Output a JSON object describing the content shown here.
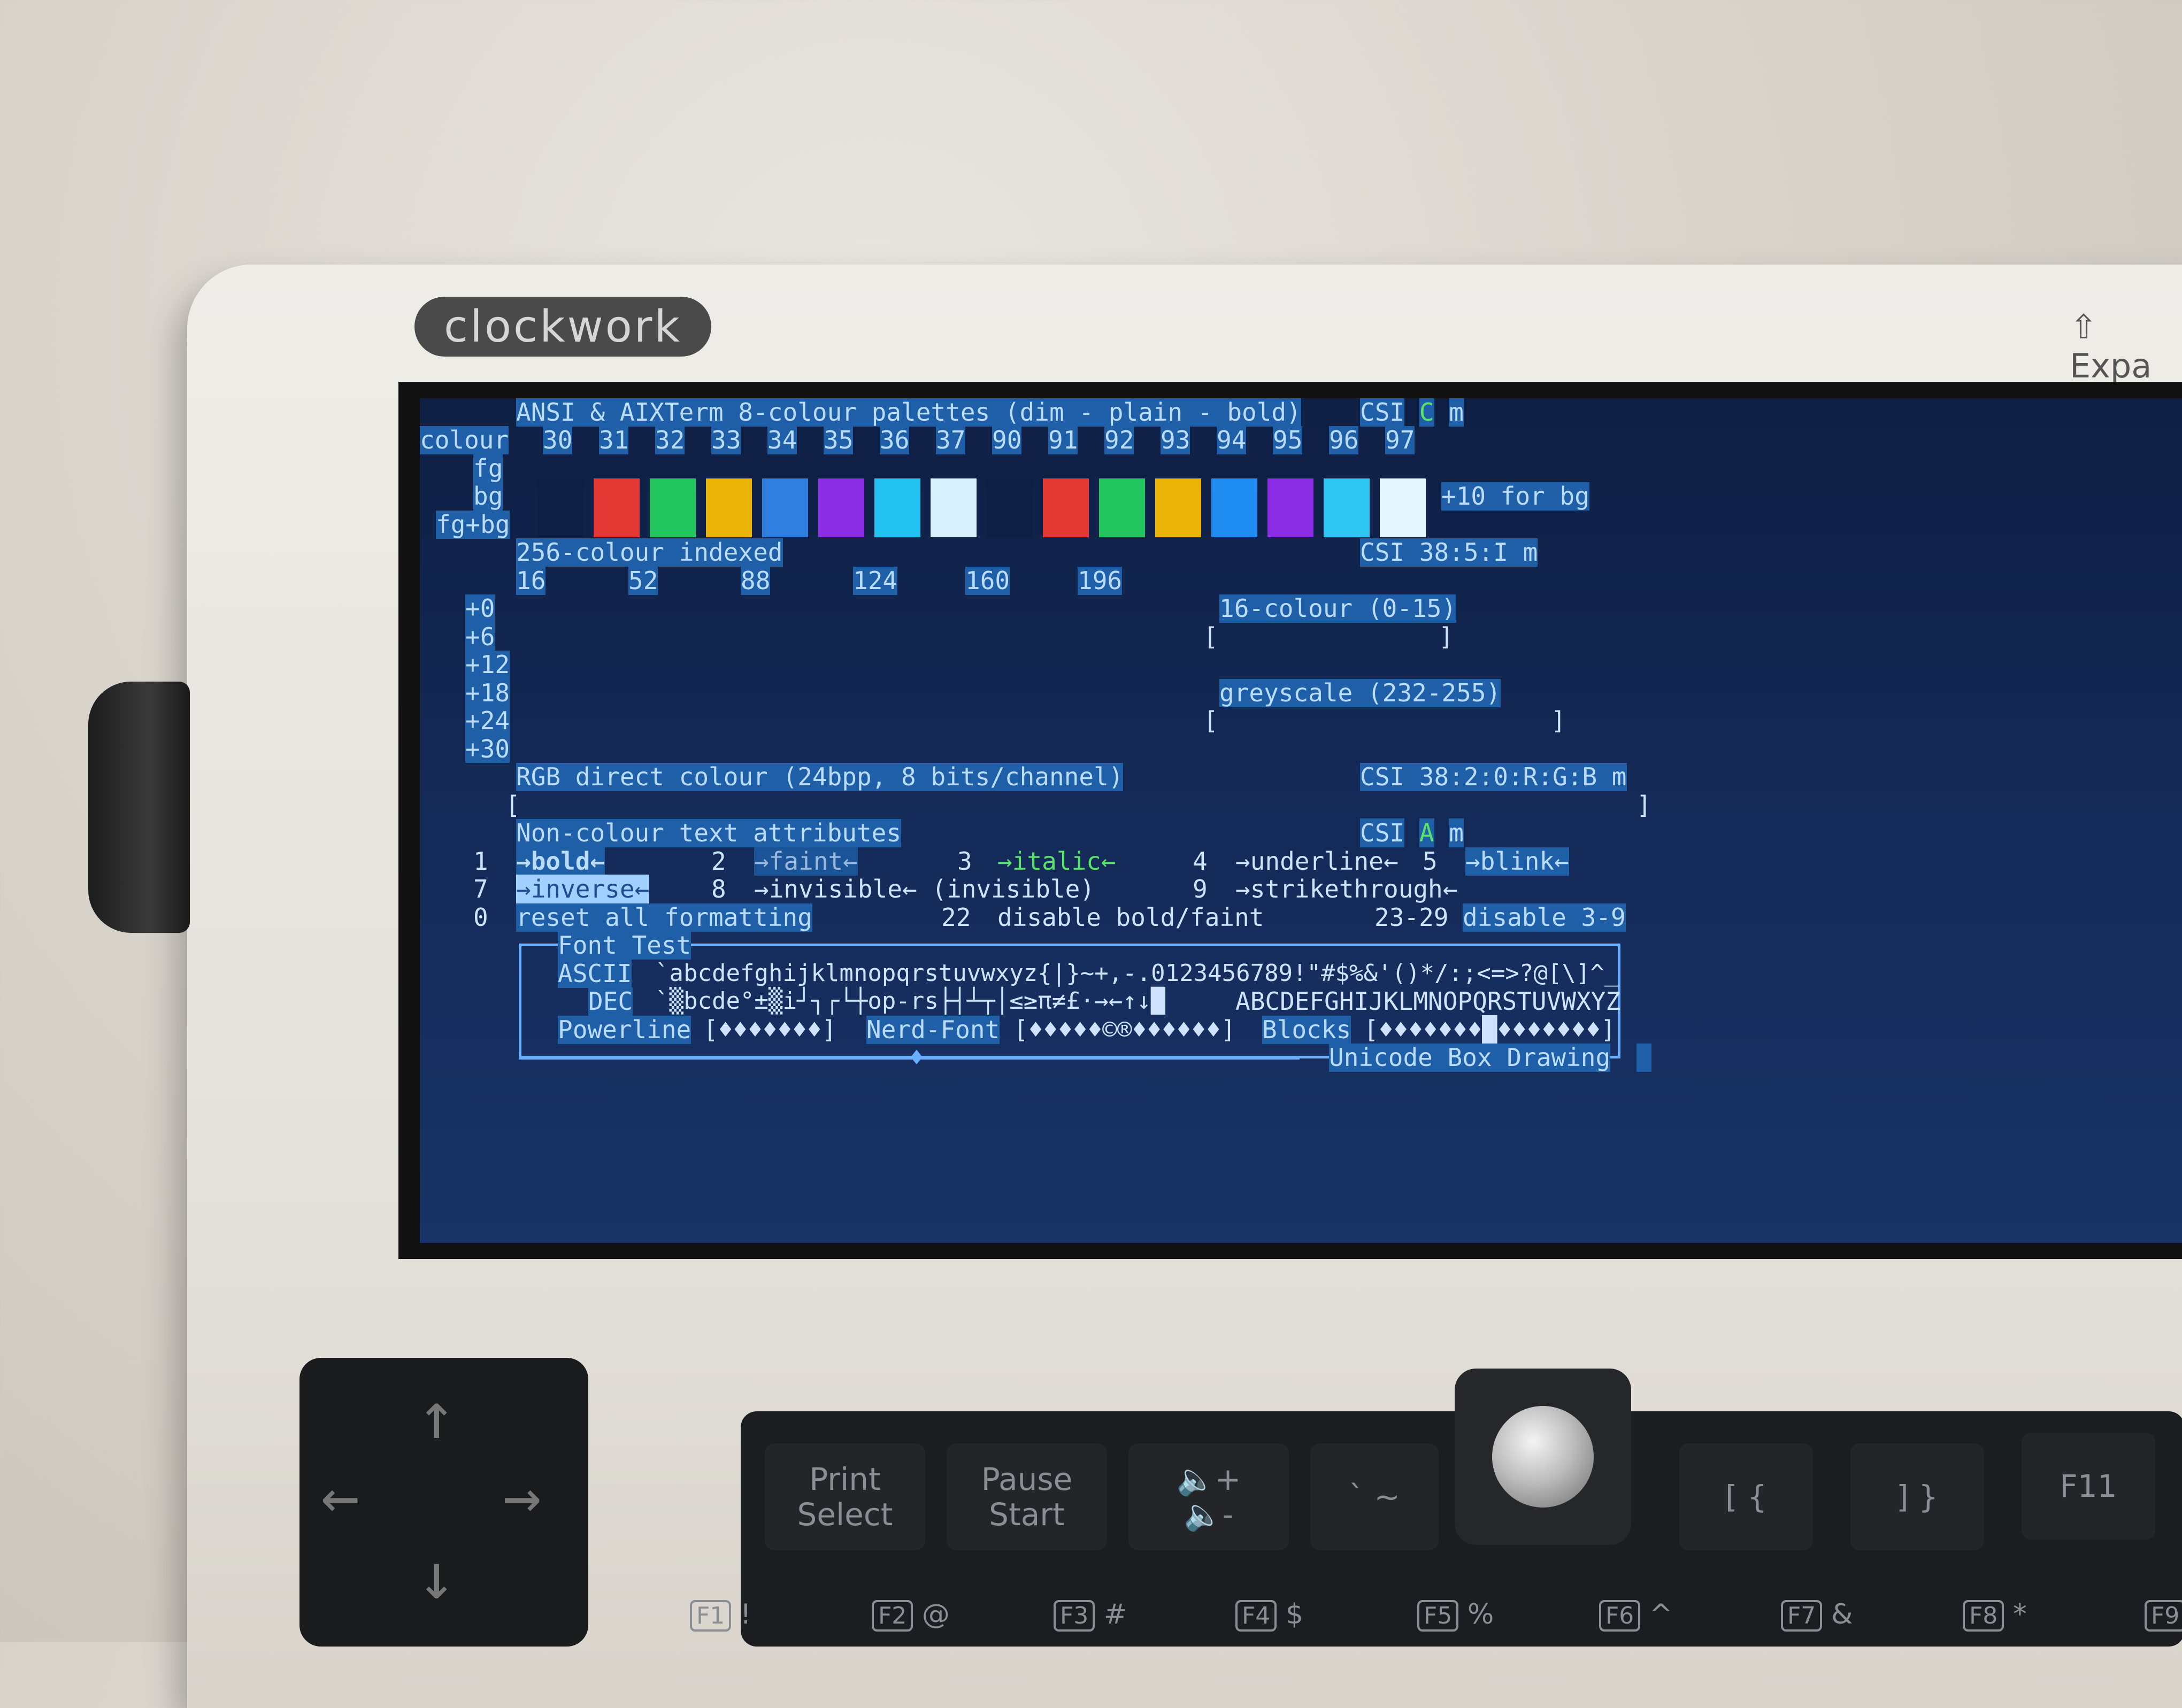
{
  "device": {
    "brand": "clockwork",
    "expand_label": "⇧ Expa"
  },
  "terminal": {
    "palette": {
      "title": "ANSI & AIXTerm 8-colour palettes (dim - plain - bold)",
      "csi": "CSI",
      "csi_param": "C",
      "csi_m": "m",
      "row_colour_label": "colour",
      "colour_codes": [
        "30",
        "31",
        "32",
        "33",
        "34",
        "35",
        "36",
        "37",
        "90",
        "91",
        "92",
        "93",
        "94",
        "95",
        "96",
        "97"
      ],
      "row_fg_label": "fg",
      "row_bg_label": "bg",
      "row_fgbg_label": "fg+bg",
      "hint": "+10 for bg",
      "swatch_colors": [
        "#0f1f44",
        "#e53935",
        "#22c55e",
        "#eab308",
        "#2f7fe0",
        "#8b2ee6",
        "#22c3f0",
        "#d9f1ff",
        "#0f1f44",
        "#e53935",
        "#22c55e",
        "#eab308",
        "#1e8cf0",
        "#8b2ee6",
        "#2fc6f2",
        "#e4f6ff"
      ]
    },
    "indexed": {
      "title": "256-colour indexed",
      "csi": "CSI 38:5:I m",
      "columns": [
        "16",
        "52",
        "88",
        "124",
        "160",
        "196"
      ],
      "rows": [
        "+0",
        "+6",
        "+12",
        "+18",
        "+24",
        "+30"
      ],
      "sixteen_label": "16-colour (0-15)",
      "greyscale_label": "greyscale (232-255)"
    },
    "rgb": {
      "title": "RGB direct colour (24bpp, 8 bits/channel)",
      "csi": "CSI 38:2:0:R:G:B m"
    },
    "attributes": {
      "title": "Non-colour text attributes",
      "csi": "CSI",
      "csi_param": "A",
      "csi_m": "m",
      "line1": [
        {
          "n": "1",
          "t": "→bold←"
        },
        {
          "n": "2",
          "t": "→faint←"
        },
        {
          "n": "3",
          "t": "→italic←"
        },
        {
          "n": "4",
          "t": "→underline←"
        },
        {
          "n": "5",
          "t": "→blink←"
        }
      ],
      "line2": [
        {
          "n": "7",
          "t": "→inverse←"
        },
        {
          "n": "8",
          "t": "→invisible← (invisible)"
        },
        {
          "n": "9",
          "t": "→strikethrough←"
        }
      ],
      "line3": [
        {
          "n": "0",
          "t": "reset all formatting"
        },
        {
          "n": "22",
          "t": "disable bold/faint"
        },
        {
          "n": "23-29",
          "t": "disable 3-9"
        }
      ]
    },
    "font_test": {
      "title": "Font Test",
      "ascii_label": "ASCII",
      "ascii_text": "`abcdefghijklmnopqrstuvwxyz{|}~+,-.0123456789!\"#$%&'()*/:;<=>?@[\\]^_",
      "dec_label": "DEC",
      "dec_text": "`▒bcde°±▒i┘┐┌└┼op-rs├┤┴┬│≤≥π≠£·→←↑↓█",
      "dec_upper": "ABCDEFGHIJKLMNOPQRSTUVWXYZ",
      "powerline_label": "Powerline",
      "powerline_glyphs": "[♦♦♦♦♦♦♦]",
      "nerd_label": "Nerd-Font",
      "nerd_glyphs": "[♦♦♦♦♦©®♦♦♦♦♦♦]",
      "blocks_label": "Blocks",
      "blocks_glyphs": "[♦♦♦♦♦♦♦█♦♦♦♦♦♦♦]",
      "unicode_label": "Unicode Box Drawing"
    }
  },
  "keyboard": {
    "print_top": "Print",
    "print_bottom": "Select",
    "pause_top": "Pause",
    "pause_bottom": "Start",
    "vol_down": "🔈-",
    "vol_up": "🔈+",
    "tilde": "` ~",
    "bracket_open": "[ {",
    "bracket_close": "] }",
    "f11": "F11",
    "f_keys": [
      {
        "label": "F1",
        "sym": "!"
      },
      {
        "label": "F2",
        "sym": "@"
      },
      {
        "label": "F3",
        "sym": "#"
      },
      {
        "label": "F4",
        "sym": "$"
      },
      {
        "label": "F5",
        "sym": "%"
      },
      {
        "label": "F6",
        "sym": "^"
      },
      {
        "label": "F7",
        "sym": "&"
      },
      {
        "label": "F8",
        "sym": "*"
      },
      {
        "label": "F9",
        "sym": ""
      }
    ]
  }
}
